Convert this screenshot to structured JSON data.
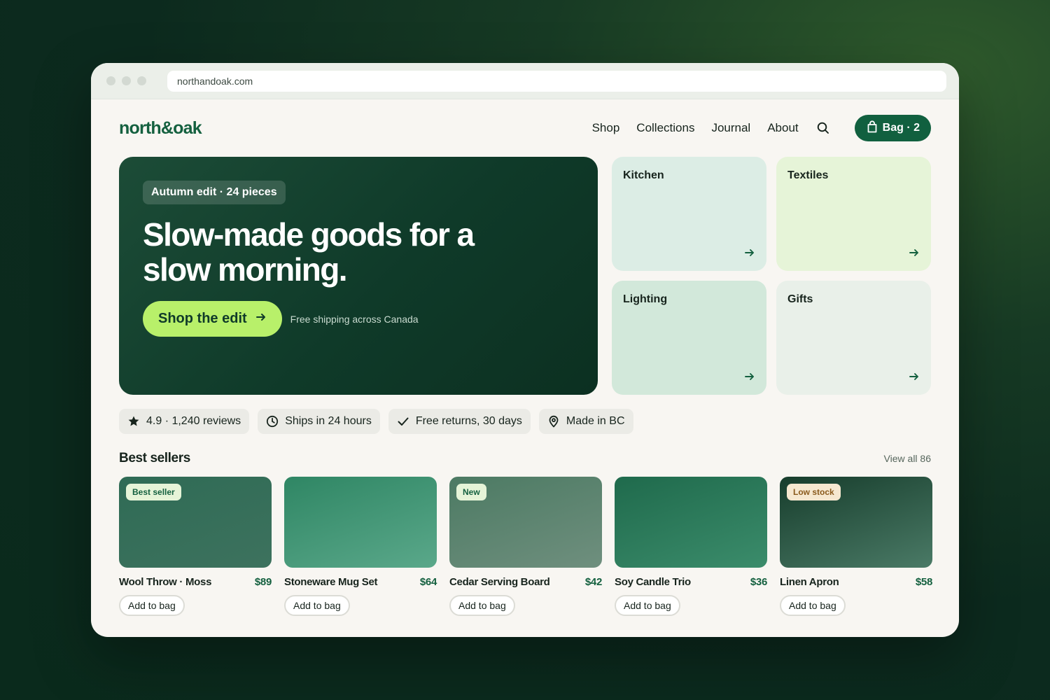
{
  "browser": {
    "url": "northandoak.com"
  },
  "header": {
    "logo": "north&oak",
    "nav": [
      "Shop",
      "Collections",
      "Journal",
      "About"
    ],
    "bag_label": "Bag · 2"
  },
  "hero": {
    "badge": "Autumn edit · 24 pieces",
    "title": "Slow-made goods for a slow morning.",
    "cta": "Shop the edit",
    "note": "Free shipping across Canada"
  },
  "categories": [
    {
      "label": "Kitchen"
    },
    {
      "label": "Textiles"
    },
    {
      "label": "Lighting"
    },
    {
      "label": "Gifts"
    }
  ],
  "features": [
    {
      "icon": "star-icon",
      "label": "4.9 · 1,240 reviews"
    },
    {
      "icon": "clock-icon",
      "label": "Ships in 24 hours"
    },
    {
      "icon": "check-icon",
      "label": "Free returns, 30 days"
    },
    {
      "icon": "location-pin-icon",
      "label": "Made in BC"
    }
  ],
  "best_sellers": {
    "title": "Best sellers",
    "view_all": "View all 86",
    "add_label": "Add to bag",
    "products": [
      {
        "name": "Wool Throw · Moss",
        "price": "$89",
        "badge": "Best seller"
      },
      {
        "name": "Stoneware Mug Set",
        "price": "$64",
        "badge": ""
      },
      {
        "name": "Cedar Serving Board",
        "price": "$42",
        "badge": "New"
      },
      {
        "name": "Soy Candle Trio",
        "price": "$36",
        "badge": ""
      },
      {
        "name": "Linen Apron",
        "price": "$58",
        "badge": "Low stock"
      }
    ]
  },
  "colors": {
    "brand_green": "#14603f",
    "cta_lime": "#b8f06a",
    "hero_dark": "#0f3a29"
  }
}
